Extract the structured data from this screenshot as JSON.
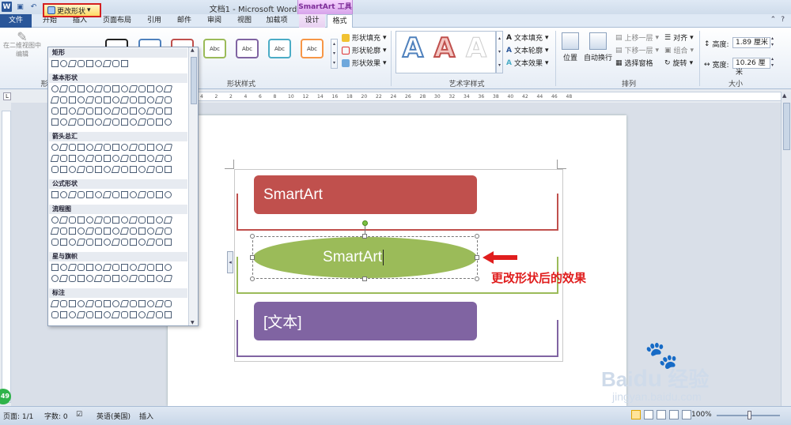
{
  "window": {
    "title": "文档1 - Microsoft Word",
    "context_header": "SmartArt 工具",
    "controls": [
      "–",
      "□",
      "✕"
    ]
  },
  "tabs": [
    {
      "label": "文件"
    },
    {
      "label": "开始"
    },
    {
      "label": "插入"
    },
    {
      "label": "页面布局"
    },
    {
      "label": "引用"
    },
    {
      "label": "邮件"
    },
    {
      "label": "审阅"
    },
    {
      "label": "视图"
    },
    {
      "label": "加载项"
    },
    {
      "label": "设计"
    },
    {
      "label": "格式"
    }
  ],
  "ribbon": {
    "change_shape": "更改形状",
    "edit_2d_line1": "在二维视图中",
    "edit_2d_line2": "编辑",
    "group_shape_short": "形",
    "style_abc": "Abc",
    "shape_fill": "形状填充",
    "shape_outline": "形状轮廓",
    "shape_effect": "形状效果",
    "group_shape_styles": "形状样式",
    "wordart_a": "A",
    "text_fill": "文本填充",
    "text_outline": "文本轮廓",
    "text_effect": "文本效果",
    "group_wordart": "艺术字样式",
    "position": "位置",
    "auto_wrap": "自动换行",
    "bring_forward": "上移一层",
    "send_backward": "下移一层",
    "selection_pane": "选择窗格",
    "align": "对齐",
    "group": "组合",
    "rotate": "旋转",
    "group_arrange": "排列",
    "height_label": "高度:",
    "height_value": "1.89 厘米",
    "width_label": "宽度:",
    "width_value": "10.26 厘米",
    "group_size": "大小"
  },
  "ruler": {
    "corner": "L",
    "marks": [
      "4",
      "2",
      "2",
      "4",
      "6",
      "8",
      "10",
      "12",
      "14",
      "16",
      "18",
      "20",
      "22",
      "24",
      "26",
      "28",
      "30",
      "32",
      "34",
      "36",
      "38",
      "40",
      "42",
      "44",
      "46",
      "48"
    ]
  },
  "shape_gallery": {
    "categories": [
      "矩形",
      "基本形状",
      "箭头总汇",
      "公式形状",
      "流程图",
      "星与旗帜",
      "标注"
    ]
  },
  "smartart": {
    "item1_text": "SmartArt",
    "item2_text": "SmartArt",
    "item3_text": "[文本]",
    "colors": {
      "red": "#c0504d",
      "green": "#9bbb59",
      "purple": "#8064a2"
    }
  },
  "annotation": "更改形状后的效果",
  "status": {
    "page": "页面: 1/1",
    "words": "字数: 0",
    "language": "英语(美国)",
    "mode": "插入",
    "zoom": "100%",
    "badge": "49"
  },
  "watermark": {
    "brand": "Bai",
    "brand_cn": "经验",
    "url": "jingyan.baidu.com"
  }
}
